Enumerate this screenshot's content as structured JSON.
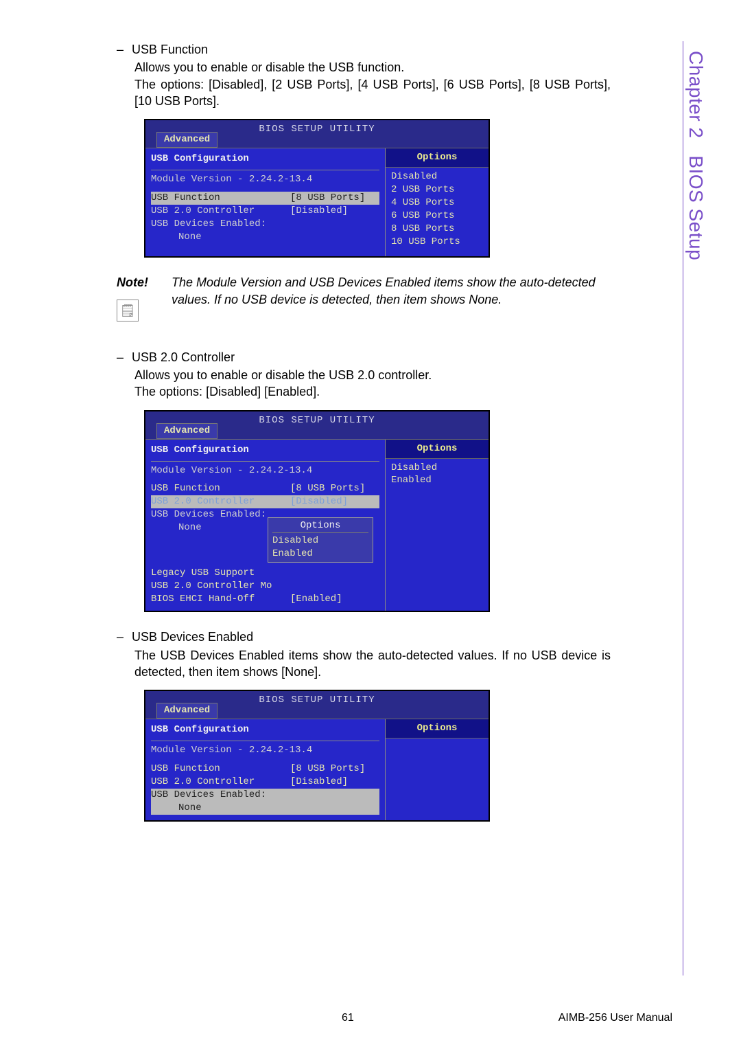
{
  "sidebar": {
    "chapter": "Chapter 2",
    "section": "BIOS Setup"
  },
  "footer": {
    "page": "61",
    "manual": "AIMB-256 User Manual"
  },
  "sec1": {
    "title": "USB Function",
    "desc1": "Allows you to enable or disable the USB function.",
    "desc2": "The options: [Disabled], [2 USB Ports], [4 USB Ports], [6 USB Ports], [8 USB Ports], [10 USB Ports]."
  },
  "bios1": {
    "title": "BIOS SETUP UTILITY",
    "tab": "Advanced",
    "section": "USB Configuration",
    "module": "Module Version - 2.24.2-13.4",
    "r1l": "USB Function",
    "r1v": "[8 USB Ports]",
    "r2l": "USB 2.0 Controller",
    "r2v": "[Disabled]",
    "r3l": "USB Devices Enabled:",
    "r3n": "None",
    "opt_header": "Options",
    "opts": {
      "o1": "Disabled",
      "o2": "2 USB Ports",
      "o3": "4 USB Ports",
      "o4": "6 USB Ports",
      "o5": "8 USB Ports",
      "o6": "10 USB Ports"
    }
  },
  "note": {
    "label": "Note!",
    "text": "The Module Version and USB Devices Enabled items show the auto-detected values. If no USB device is detected, then item shows None."
  },
  "sec2": {
    "title": "USB 2.0 Controller",
    "desc1": "Allows you to enable or disable the USB 2.0 controller.",
    "desc2": "The options: [Disabled] [Enabled]."
  },
  "bios2": {
    "title": "BIOS SETUP UTILITY",
    "tab": "Advanced",
    "section": "USB Configuration",
    "module": "Module Version - 2.24.2-13.4",
    "r1l": "USB Function",
    "r1v": "[8 USB Ports]",
    "r2l": "USB 2.0 Controller",
    "r2v": "[Disabled]",
    "r3l": "USB Devices Enabled:",
    "r3n": "None",
    "r4l": "Legacy USB Support",
    "r5l": "USB 2.0 Controller Mo",
    "r6l": "BIOS EHCI Hand-Off",
    "r6v": "[Enabled]",
    "popup_title": "Options",
    "p1": "Disabled",
    "p2": "Enabled",
    "opt_header": "Options",
    "opts": {
      "o1": "Disabled",
      "o2": "Enabled"
    }
  },
  "sec3": {
    "title": "USB Devices Enabled",
    "desc1": "The USB Devices Enabled items show the auto-detected values. If no USB device is detected, then item shows [None]."
  },
  "bios3": {
    "title": "BIOS SETUP UTILITY",
    "tab": "Advanced",
    "section": "USB Configuration",
    "module": "Module Version - 2.24.2-13.4",
    "r1l": "USB Function",
    "r1v": "[8 USB Ports]",
    "r2l": "USB 2.0 Controller",
    "r2v": "[Disabled]",
    "r3l": "USB Devices Enabled:",
    "r3n": "None",
    "opt_header": "Options"
  }
}
